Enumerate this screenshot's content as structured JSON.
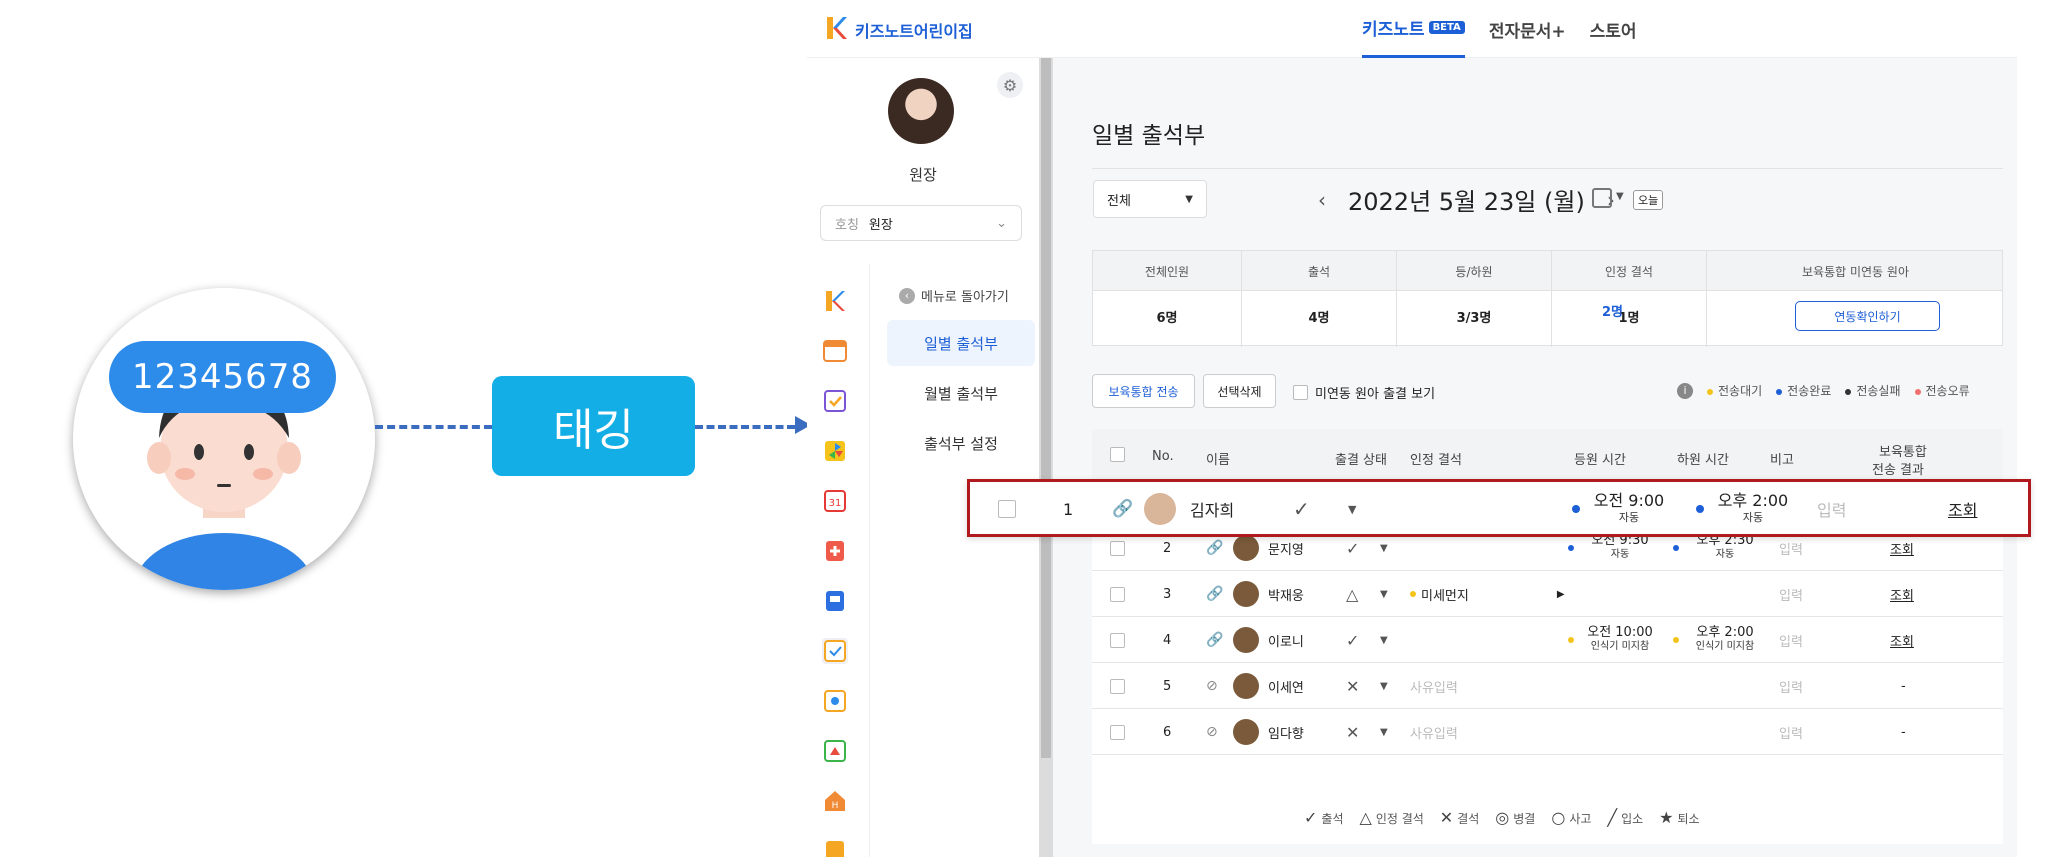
{
  "illustration": {
    "card_number": "12345678",
    "tag_label": "태깅"
  },
  "app": {
    "brand": "키즈노트어린이집",
    "nav": [
      {
        "label": "키즈노트",
        "badge": "BETA"
      },
      {
        "label": "전자문서+"
      },
      {
        "label": "스토어"
      }
    ],
    "profile": {
      "role": "원장",
      "title_label": "호칭",
      "title_value": "원장"
    },
    "submenu": {
      "back": "메뉴로 돌아가기",
      "items": [
        "일별 출석부",
        "월별 출석부",
        "출석부 설정"
      ]
    },
    "page_title": "일별 출석부",
    "class_filter": "전체",
    "date": "2022년 5월 23일 (월)",
    "today": "오늘",
    "stats": [
      {
        "label": "전체인원",
        "value": "6명"
      },
      {
        "label": "출석",
        "value": "4명"
      },
      {
        "label": "등/하원",
        "value": "3/3명"
      },
      {
        "label": "인정 결석",
        "value": "1명"
      },
      {
        "label": "보육통합 미연동 원아",
        "value": "2명",
        "button": "연동확인하기"
      }
    ],
    "actions": {
      "send": "보육통합 전송",
      "delete": "선택삭제",
      "show_unlinked": "미연동 원아 출결 보기"
    },
    "send_legend": [
      {
        "label": "전송대기",
        "color": "#f5c31a"
      },
      {
        "label": "전송완료",
        "color": "#1d5fd6"
      },
      {
        "label": "전송실패",
        "color": "#333333"
      },
      {
        "label": "전송오류",
        "color": "#f07070"
      }
    ],
    "columns": [
      "No.",
      "이름",
      "출결 상태",
      "인정 결석",
      "등원 시간",
      "하원 시간",
      "비고",
      "보육통합",
      "전송 결과"
    ],
    "rows": [
      {
        "no": "1",
        "name": "김자희",
        "status": "✓",
        "reason": "",
        "in_time": "오전 9:00",
        "in_note": "자동",
        "in_dot": "#1d5fd6",
        "out_time": "오후 2:00",
        "out_note": "자동",
        "out_dot": "#1d5fd6",
        "memo": "입력",
        "result": "조회",
        "linked": true
      },
      {
        "no": "2",
        "name": "문지영",
        "status": "✓",
        "reason": "",
        "in_time": "오전 9:30",
        "in_note": "자동",
        "in_dot": "#1d5fd6",
        "out_time": "오후 2:30",
        "out_note": "자동",
        "out_dot": "#1d5fd6",
        "memo": "입력",
        "result": "조회",
        "linked": true
      },
      {
        "no": "3",
        "name": "박재웅",
        "status": "△",
        "reason": "미세먼지",
        "in_time": "",
        "in_note": "",
        "in_dot": "",
        "out_time": "",
        "out_note": "",
        "out_dot": "",
        "memo": "입력",
        "result": "조회",
        "linked": true
      },
      {
        "no": "4",
        "name": "이로니",
        "status": "✓",
        "reason": "",
        "in_time": "오전 10:00",
        "in_note": "인식기 미지참",
        "in_dot": "#f5c31a",
        "out_time": "오후 2:00",
        "out_note": "인식기 미지참",
        "out_dot": "#f5c31a",
        "memo": "입력",
        "result": "조회",
        "linked": true
      },
      {
        "no": "5",
        "name": "이세연",
        "status": "✕",
        "reason": "사유입력",
        "in_time": "",
        "in_note": "",
        "in_dot": "",
        "out_time": "",
        "out_note": "",
        "out_dot": "",
        "memo": "입력",
        "result": "-",
        "linked": false
      },
      {
        "no": "6",
        "name": "임다향",
        "status": "✕",
        "reason": "사유입력",
        "in_time": "",
        "in_note": "",
        "in_dot": "",
        "out_time": "",
        "out_note": "",
        "out_dot": "",
        "memo": "입력",
        "result": "-",
        "linked": false
      }
    ],
    "status_legend": [
      {
        "glyph": "✓",
        "label": "출석"
      },
      {
        "glyph": "△",
        "label": "인정 결석"
      },
      {
        "glyph": "✕",
        "label": "결석"
      },
      {
        "glyph": "◎",
        "label": "병결"
      },
      {
        "glyph": "○",
        "label": "사고"
      },
      {
        "glyph": "╱",
        "label": "입소"
      },
      {
        "glyph": "★",
        "label": "퇴소"
      }
    ]
  }
}
